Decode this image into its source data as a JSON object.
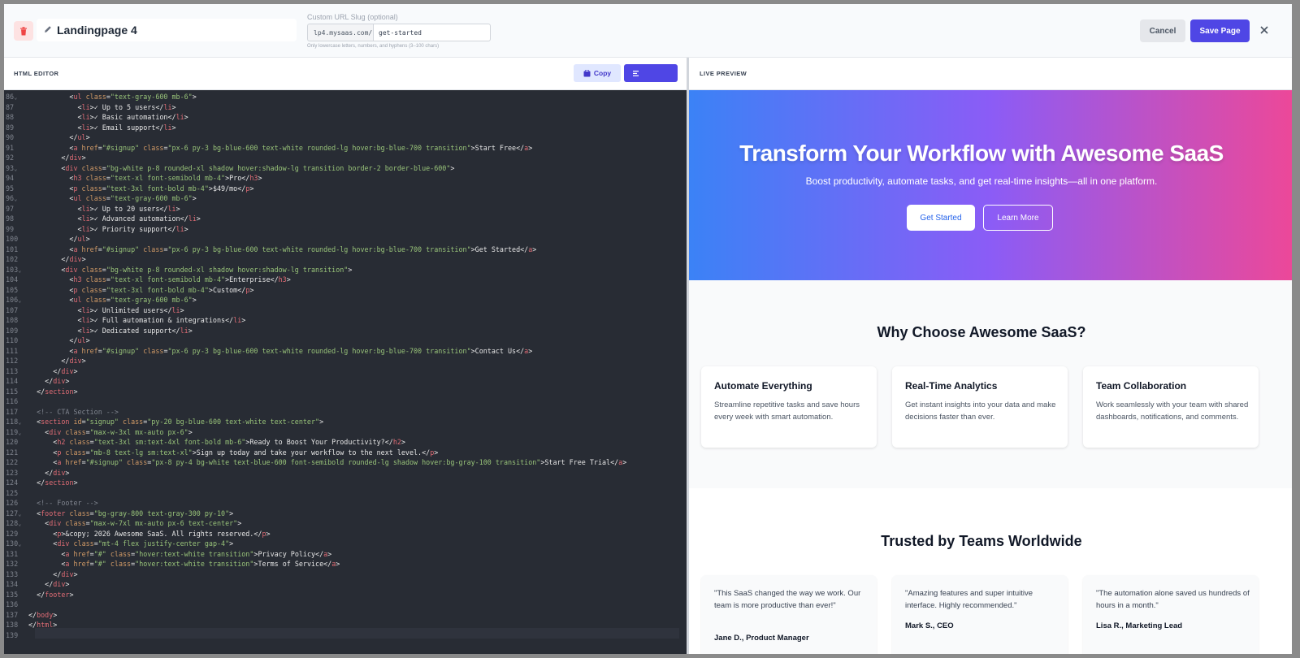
{
  "header": {
    "page_name": "Landingpage 4",
    "slug_label": "Custom URL Slug (optional)",
    "slug_prefix": "lp4.mysaas.com/",
    "slug_value": "get-started",
    "slug_hint": "Only lowercase letters, numbers, and hyphens (3–100 chars)",
    "cancel_label": "Cancel",
    "save_label": "Save Page",
    "close_icon": "close-icon",
    "trash_icon": "trash-icon",
    "pencil_icon": "pencil-icon"
  },
  "editor": {
    "title": "HTML EDITOR",
    "copy_label": "Copy",
    "copy_icon": "clipboard-icon",
    "format_icon": "format-icon",
    "lines": [
      {
        "n": "86",
        "fold": true,
        "text": "          <ul class=\"text-gray-600 mb-6\">"
      },
      {
        "n": "87",
        "fold": false,
        "text": "            <li>✓ Up to 5 users</li>"
      },
      {
        "n": "88",
        "fold": false,
        "text": "            <li>✓ Basic automation</li>"
      },
      {
        "n": "89",
        "fold": false,
        "text": "            <li>✓ Email support</li>"
      },
      {
        "n": "90",
        "fold": false,
        "text": "          </ul>"
      },
      {
        "n": "91",
        "fold": false,
        "text": "          <a href=\"#signup\" class=\"px-6 py-3 bg-blue-600 text-white rounded-lg hover:bg-blue-700 transition\">Start Free</a>"
      },
      {
        "n": "92",
        "fold": false,
        "text": "        </div>"
      },
      {
        "n": "93",
        "fold": true,
        "text": "        <div class=\"bg-white p-8 rounded-xl shadow hover:shadow-lg transition border-2 border-blue-600\">"
      },
      {
        "n": "94",
        "fold": false,
        "text": "          <h3 class=\"text-xl font-semibold mb-4\">Pro</h3>"
      },
      {
        "n": "95",
        "fold": false,
        "text": "          <p class=\"text-3xl font-bold mb-4\">$49/mo</p>"
      },
      {
        "n": "96",
        "fold": true,
        "text": "          <ul class=\"text-gray-600 mb-6\">"
      },
      {
        "n": "97",
        "fold": false,
        "text": "            <li>✓ Up to 20 users</li>"
      },
      {
        "n": "98",
        "fold": false,
        "text": "            <li>✓ Advanced automation</li>"
      },
      {
        "n": "99",
        "fold": false,
        "text": "            <li>✓ Priority support</li>"
      },
      {
        "n": "100",
        "fold": false,
        "text": "          </ul>"
      },
      {
        "n": "101",
        "fold": false,
        "text": "          <a href=\"#signup\" class=\"px-6 py-3 bg-blue-600 text-white rounded-lg hover:bg-blue-700 transition\">Get Started</a>"
      },
      {
        "n": "102",
        "fold": false,
        "text": "        </div>"
      },
      {
        "n": "103",
        "fold": true,
        "text": "        <div class=\"bg-white p-8 rounded-xl shadow hover:shadow-lg transition\">"
      },
      {
        "n": "104",
        "fold": false,
        "text": "          <h3 class=\"text-xl font-semibold mb-4\">Enterprise</h3>"
      },
      {
        "n": "105",
        "fold": false,
        "text": "          <p class=\"text-3xl font-bold mb-4\">Custom</p>"
      },
      {
        "n": "106",
        "fold": true,
        "text": "          <ul class=\"text-gray-600 mb-6\">"
      },
      {
        "n": "107",
        "fold": false,
        "text": "            <li>✓ Unlimited users</li>"
      },
      {
        "n": "108",
        "fold": false,
        "text": "            <li>✓ Full automation & integrations</li>"
      },
      {
        "n": "109",
        "fold": false,
        "text": "            <li>✓ Dedicated support</li>"
      },
      {
        "n": "110",
        "fold": false,
        "text": "          </ul>"
      },
      {
        "n": "111",
        "fold": false,
        "text": "          <a href=\"#signup\" class=\"px-6 py-3 bg-blue-600 text-white rounded-lg hover:bg-blue-700 transition\">Contact Us</a>"
      },
      {
        "n": "112",
        "fold": false,
        "text": "        </div>"
      },
      {
        "n": "113",
        "fold": false,
        "text": "      </div>"
      },
      {
        "n": "114",
        "fold": false,
        "text": "    </div>"
      },
      {
        "n": "115",
        "fold": false,
        "text": "  </section>"
      },
      {
        "n": "116",
        "fold": false,
        "text": ""
      },
      {
        "n": "117",
        "fold": false,
        "text": "  <!-- CTA Section -->"
      },
      {
        "n": "118",
        "fold": true,
        "text": "  <section id=\"signup\" class=\"py-20 bg-blue-600 text-white text-center\">"
      },
      {
        "n": "119",
        "fold": true,
        "text": "    <div class=\"max-w-3xl mx-auto px-6\">"
      },
      {
        "n": "120",
        "fold": false,
        "text": "      <h2 class=\"text-3xl sm:text-4xl font-bold mb-6\">Ready to Boost Your Productivity?</h2>"
      },
      {
        "n": "121",
        "fold": false,
        "text": "      <p class=\"mb-8 text-lg sm:text-xl\">Sign up today and take your workflow to the next level.</p>"
      },
      {
        "n": "122",
        "fold": false,
        "text": "      <a href=\"#signup\" class=\"px-8 py-4 bg-white text-blue-600 font-semibold rounded-lg shadow hover:bg-gray-100 transition\">Start Free Trial</a>"
      },
      {
        "n": "123",
        "fold": false,
        "text": "    </div>"
      },
      {
        "n": "124",
        "fold": false,
        "text": "  </section>"
      },
      {
        "n": "125",
        "fold": false,
        "text": ""
      },
      {
        "n": "126",
        "fold": false,
        "text": "  <!-- Footer -->"
      },
      {
        "n": "127",
        "fold": true,
        "text": "  <footer class=\"bg-gray-800 text-gray-300 py-10\">"
      },
      {
        "n": "128",
        "fold": true,
        "text": "    <div class=\"max-w-7xl mx-auto px-6 text-center\">"
      },
      {
        "n": "129",
        "fold": false,
        "text": "      <p>&copy; 2026 Awesome SaaS. All rights reserved.</p>"
      },
      {
        "n": "130",
        "fold": true,
        "text": "      <div class=\"mt-4 flex justify-center gap-4\">"
      },
      {
        "n": "131",
        "fold": false,
        "text": "        <a href=\"#\" class=\"hover:text-white transition\">Privacy Policy</a>"
      },
      {
        "n": "132",
        "fold": false,
        "text": "        <a href=\"#\" class=\"hover:text-white transition\">Terms of Service</a>"
      },
      {
        "n": "133",
        "fold": false,
        "text": "      </div>"
      },
      {
        "n": "134",
        "fold": false,
        "text": "    </div>"
      },
      {
        "n": "135",
        "fold": false,
        "text": "  </footer>"
      },
      {
        "n": "136",
        "fold": false,
        "text": ""
      },
      {
        "n": "137",
        "fold": false,
        "text": "</body>"
      },
      {
        "n": "138",
        "fold": false,
        "text": "</html>"
      },
      {
        "n": "139",
        "fold": false,
        "text": ""
      }
    ]
  },
  "preview": {
    "title": "LIVE PREVIEW",
    "hero_title": "Transform Your Workflow with Awesome SaaS",
    "hero_sub": "Boost productivity, automate tasks, and get real-time insights—all in one platform.",
    "btn_get_started": "Get Started",
    "btn_learn_more": "Learn More",
    "why_title": "Why Choose Awesome SaaS?",
    "features": [
      {
        "title": "Automate Everything",
        "text": "Streamline repetitive tasks and save hours every week with smart automation."
      },
      {
        "title": "Real-Time Analytics",
        "text": "Get instant insights into your data and make decisions faster than ever."
      },
      {
        "title": "Team Collaboration",
        "text": "Work seamlessly with your team with shared dashboards, notifications, and comments."
      }
    ],
    "trusted_title": "Trusted by Teams Worldwide",
    "testimonials": [
      {
        "quote": "\"This SaaS changed the way we work. Our team is more productive than ever!\"",
        "author": "Jane D., Product Manager"
      },
      {
        "quote": "\"Amazing features and super intuitive interface. Highly recommended.\"",
        "author": "Mark S., CEO"
      },
      {
        "quote": "\"The automation alone saved us hundreds of hours in a month.\"",
        "author": "Lisa R., Marketing Lead"
      }
    ]
  },
  "colors": {
    "accent": "#4f46e5",
    "editor_bg": "#282c34",
    "tag": "#e06c75",
    "attr": "#d19a66",
    "string": "#98c379",
    "comment": "#7f848e"
  }
}
